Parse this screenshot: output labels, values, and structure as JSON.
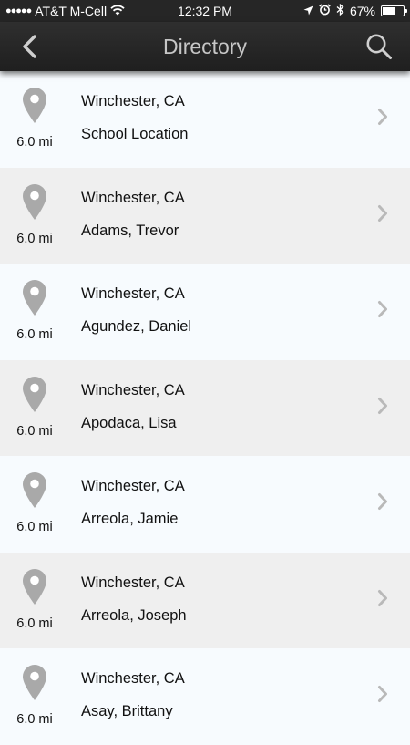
{
  "status_bar": {
    "signal_dots": "●●●●●",
    "carrier": "AT&T M-Cell",
    "time": "12:32 PM",
    "battery_percent": "67%",
    "battery_level": 0.67
  },
  "nav": {
    "title": "Directory"
  },
  "entries": [
    {
      "distance": "6.0 mi",
      "city": "Winchester, CA",
      "name": "School Location"
    },
    {
      "distance": "6.0 mi",
      "city": "Winchester, CA",
      "name": "Adams, Trevor"
    },
    {
      "distance": "6.0 mi",
      "city": "Winchester, CA",
      "name": "Agundez, Daniel"
    },
    {
      "distance": "6.0 mi",
      "city": "Winchester, CA",
      "name": "Apodaca, Lisa"
    },
    {
      "distance": "6.0 mi",
      "city": "Winchester, CA",
      "name": "Arreola, Jamie"
    },
    {
      "distance": "6.0 mi",
      "city": "Winchester, CA",
      "name": "Arreola, Joseph"
    },
    {
      "distance": "6.0 mi",
      "city": "Winchester, CA",
      "name": "Asay, Brittany"
    }
  ],
  "colors": {
    "nav_bg": "#262626",
    "row_light": "#f7fbfe",
    "row_shaded": "#efefef",
    "pin": "#a9a9a9",
    "chevron": "#b9b9b9"
  }
}
